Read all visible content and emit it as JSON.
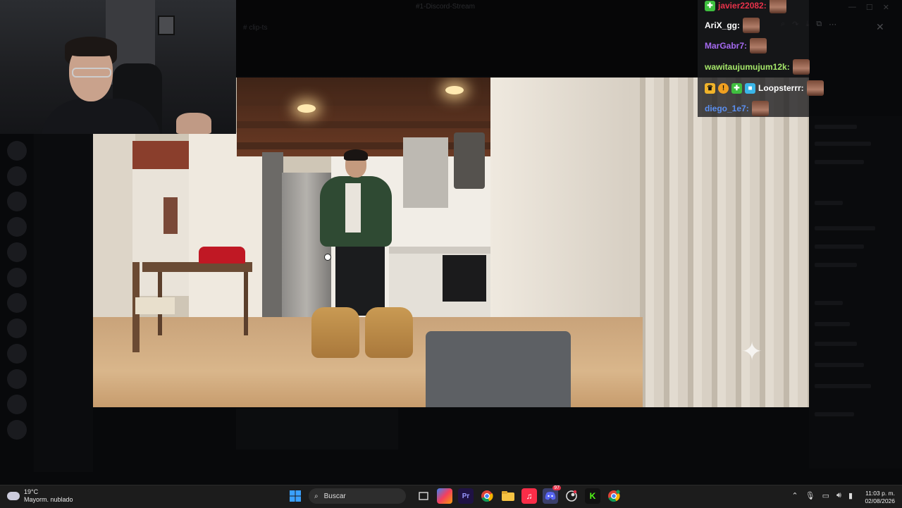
{
  "background_app": {
    "window_title": "#1-Discord-Stream",
    "channel_label": "# clip-ts",
    "window_controls": [
      "—",
      "☐",
      "✕"
    ],
    "toolbar_icons": [
      "zoom-icon",
      "share-icon",
      "download-icon",
      "popout-icon",
      "more-icon"
    ]
  },
  "stream_chat": {
    "messages": [
      {
        "user": "javier22082:",
        "color": "#e8324a",
        "badges": [
          "plus-badge"
        ]
      },
      {
        "user": "AriX_gg:",
        "color": "#ffffff",
        "badges": []
      },
      {
        "user": "MarGabr7:",
        "color": "#a56af0",
        "badges": []
      },
      {
        "user": "wawitaujumujum12k:",
        "color": "#a6e86a",
        "badges": []
      },
      {
        "user": "Loopsterrr:",
        "color": "#ffffff",
        "badges": [
          "crown-badge",
          "info-badge",
          "plus-badge",
          "cube-badge"
        ]
      },
      {
        "user": "diego_1e7:",
        "color": "#5b8ff0",
        "badges": []
      }
    ]
  },
  "taskbar": {
    "weather": {
      "temp": "19°C",
      "condition": "Mayorm. nublado"
    },
    "search_placeholder": "Buscar",
    "apps": [
      "windows-start-icon",
      "search-box",
      "task-view-icon",
      "copilot-icon",
      "premiere-icon",
      "chrome-icon",
      "file-explorer-icon",
      "music-icon",
      "discord-icon",
      "steam-icon",
      "kick-icon",
      "chrome-dev-icon"
    ],
    "discord_badge": "97",
    "clock": {
      "time": "11:03 p. m.",
      "date": "02/08/2026"
    },
    "accent_colors": {
      "windows": "#3aa0ff",
      "discord": "#5865f2",
      "kick": "#53fc18",
      "premiere": "#9999ff"
    }
  }
}
